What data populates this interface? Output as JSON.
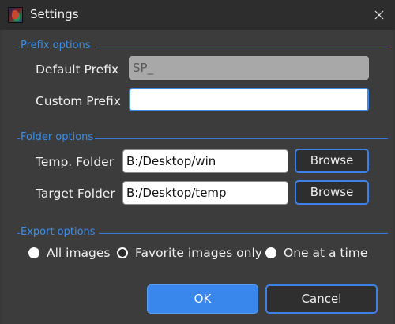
{
  "window": {
    "title": "Settings",
    "icon": "app-logo-icon",
    "close_icon": "close-icon"
  },
  "prefix_options": {
    "group_label": "Prefix options",
    "default_prefix_label": "Default Prefix",
    "default_prefix_value": "SP_",
    "custom_prefix_label": "Custom Prefix",
    "custom_prefix_value": ""
  },
  "folder_options": {
    "group_label": "Folder options",
    "temp_folder_label": "Temp. Folder",
    "temp_folder_value": "B:/Desktop/win",
    "target_folder_label": "Target Folder",
    "target_folder_value": "B:/Desktop/temp",
    "browse_label": "Browse"
  },
  "export_options": {
    "group_label": "Export options",
    "options": [
      {
        "label": "All images",
        "selected": false
      },
      {
        "label": "Favorite images only",
        "selected": true
      },
      {
        "label": "One at a time",
        "selected": false
      }
    ]
  },
  "buttons": {
    "ok_label": "OK",
    "cancel_label": "Cancel"
  },
  "colors": {
    "accent": "#3b8eea",
    "background": "#3c3c3c",
    "titlebar": "#2d2d2d"
  }
}
